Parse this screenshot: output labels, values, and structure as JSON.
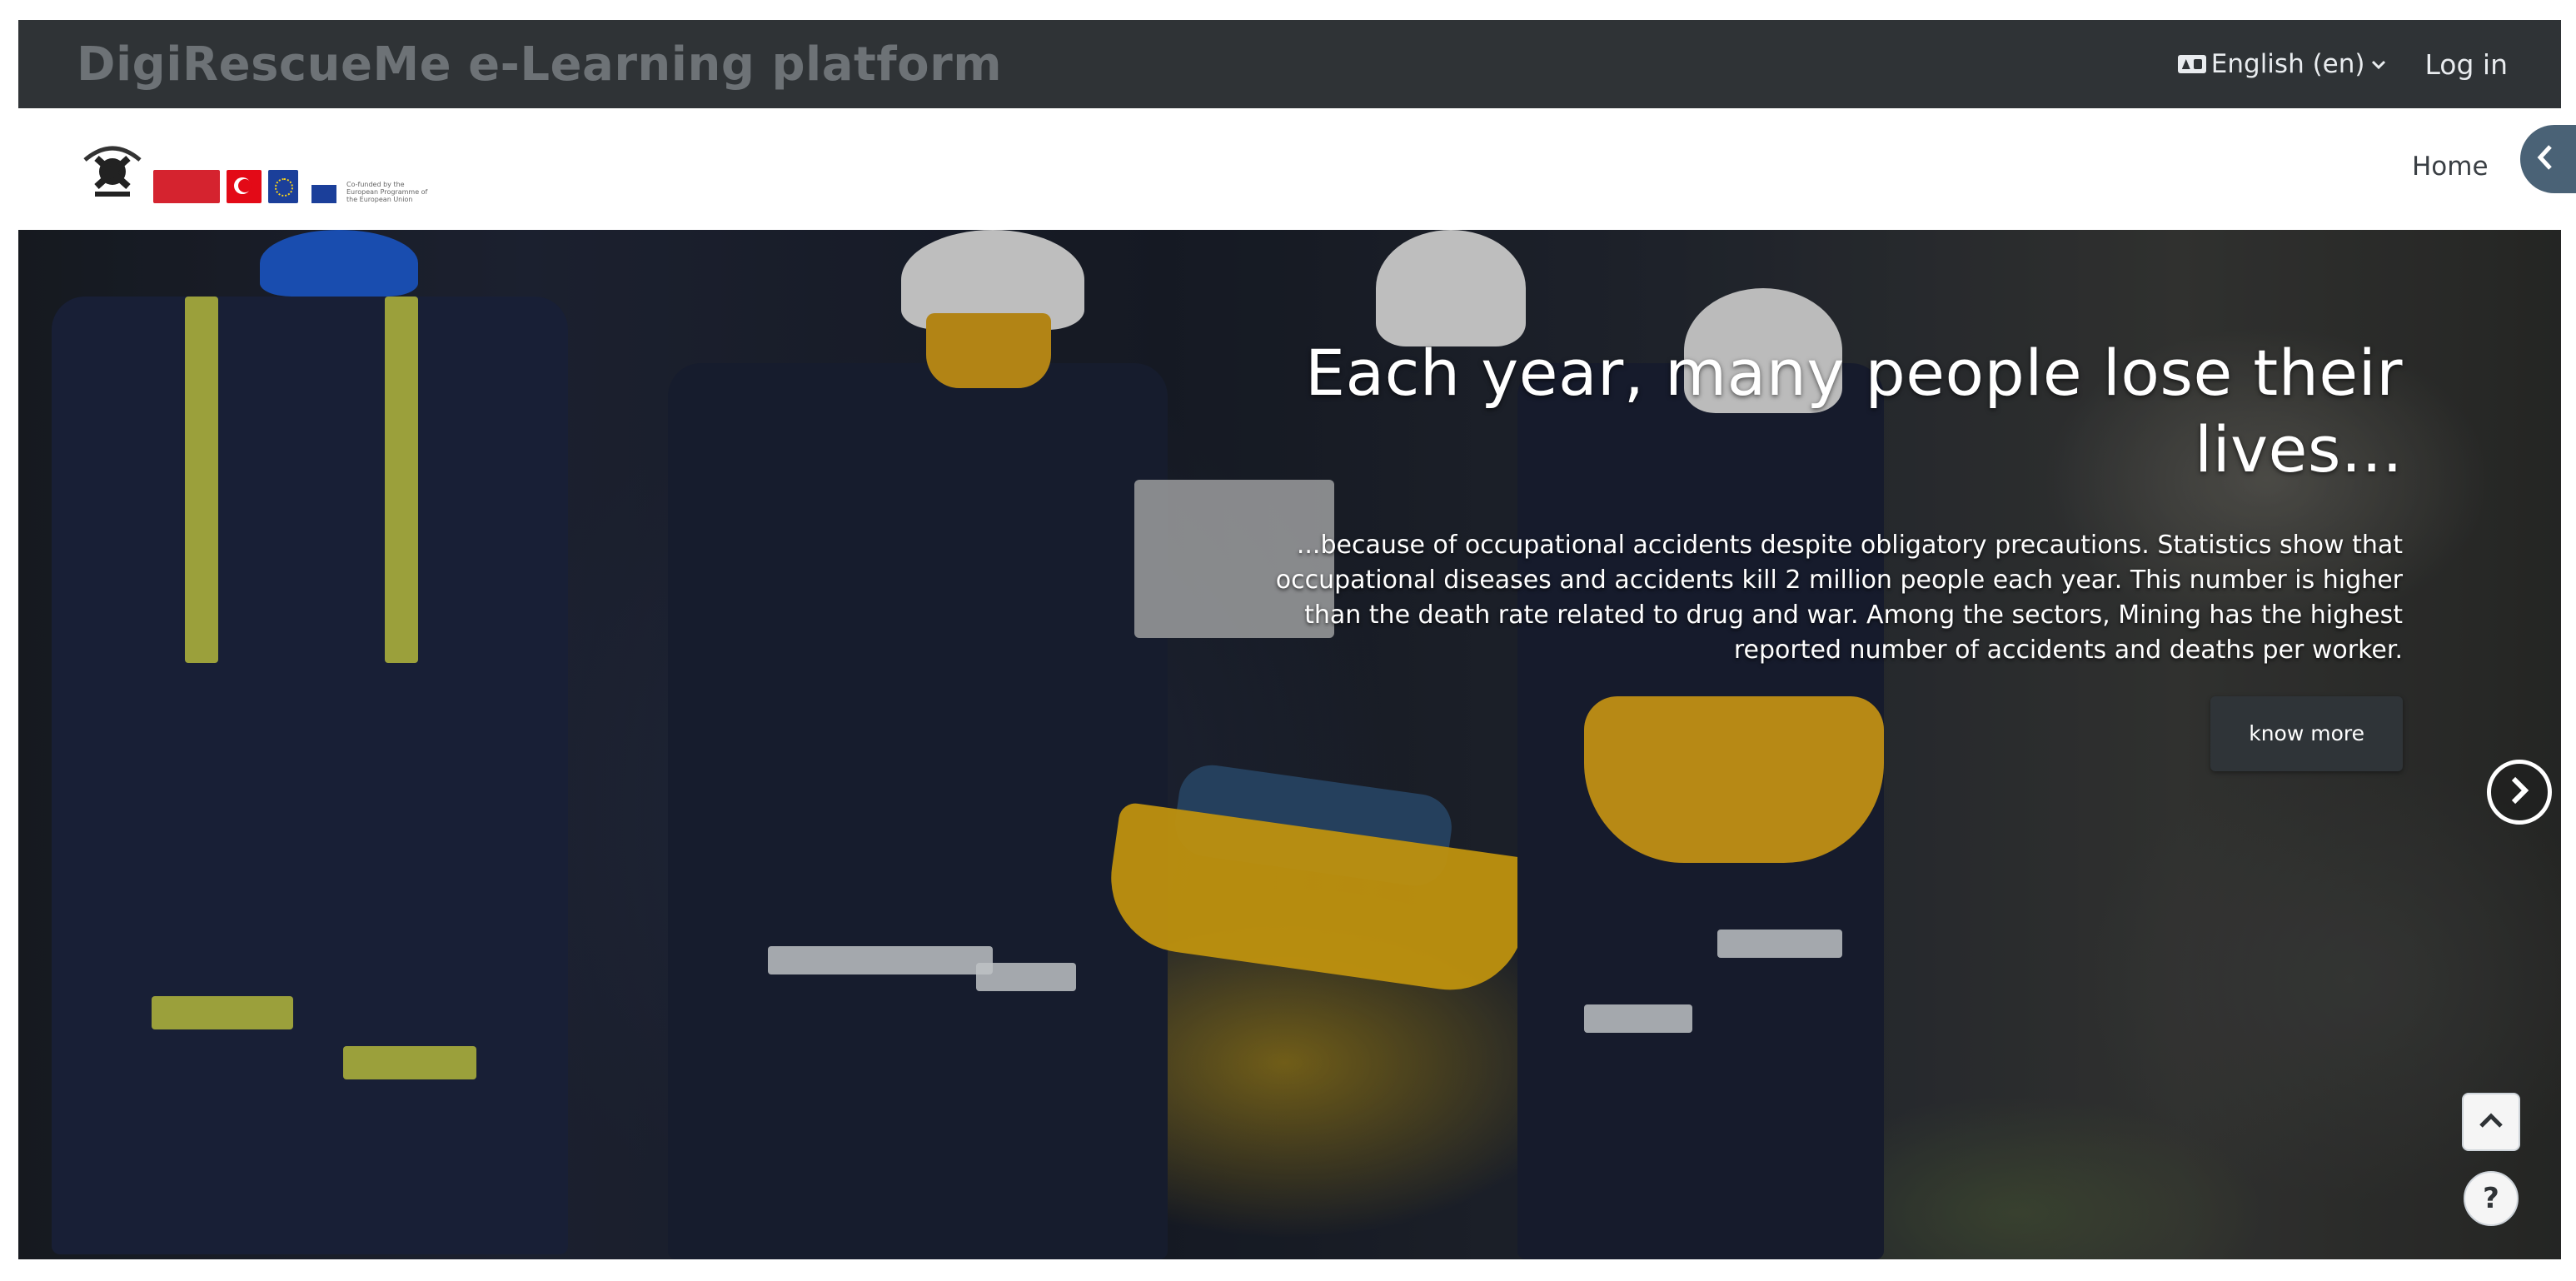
{
  "header": {
    "site_title": "DigiRescueMe e-Learning platform",
    "language_label": "English ‎(en)‎",
    "login_label": "Log in"
  },
  "nav": {
    "home_label": "Home",
    "funding_note": "Co-funded by the European Programme of the European Union"
  },
  "hero": {
    "heading": "Each year, many people lose their lives...",
    "body": "...because of occupational accidents despite obligatory precautions. Statistics show that occupational diseases and accidents kill 2 million people each year. This number is higher than the death rate related to drug and war. Among the sectors, Mining has the highest reported number of accidents and deaths per worker.",
    "button_label": "know more"
  },
  "icons": {
    "language": "translate-icon",
    "language_caret": "chevron-down-icon",
    "drawer": "chevron-left-icon",
    "carousel_next": "chevron-right-icon",
    "scroll_top": "chevron-up-icon",
    "help": "question-icon"
  },
  "colors": {
    "topbar": "#2f3336",
    "site_title": "#6d7276",
    "drawer_toggle": "#4a6276",
    "button": "#2f3438"
  },
  "help_label": "?"
}
